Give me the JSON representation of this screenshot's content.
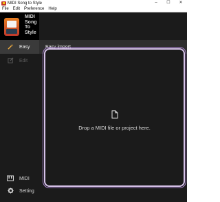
{
  "window": {
    "title": "MIDI Song to Style",
    "minimize": "–",
    "maximize": "☐",
    "close": "✕"
  },
  "menu": [
    "File",
    "Edit",
    "Preference",
    "Help"
  ],
  "logo": {
    "lines": [
      "MIDI",
      "Song",
      "To",
      "Style"
    ]
  },
  "sidebar": {
    "items": [
      {
        "label": "Easy",
        "icon": "wand-icon"
      },
      {
        "label": "Edit",
        "icon": "edit-icon"
      }
    ],
    "bottom_items": [
      {
        "label": "MIDI",
        "icon": "midi-keyboard-icon"
      },
      {
        "label": "Setting",
        "icon": "gear-icon"
      }
    ]
  },
  "header": {
    "title": "Easy import"
  },
  "dropzone": {
    "text": "Drop a MIDI file or project here.",
    "icon": "file-icon"
  },
  "colors": {
    "accent": "#d7c3ea",
    "background": "#1b1b1b",
    "active_nav": "#3a3a3a"
  }
}
